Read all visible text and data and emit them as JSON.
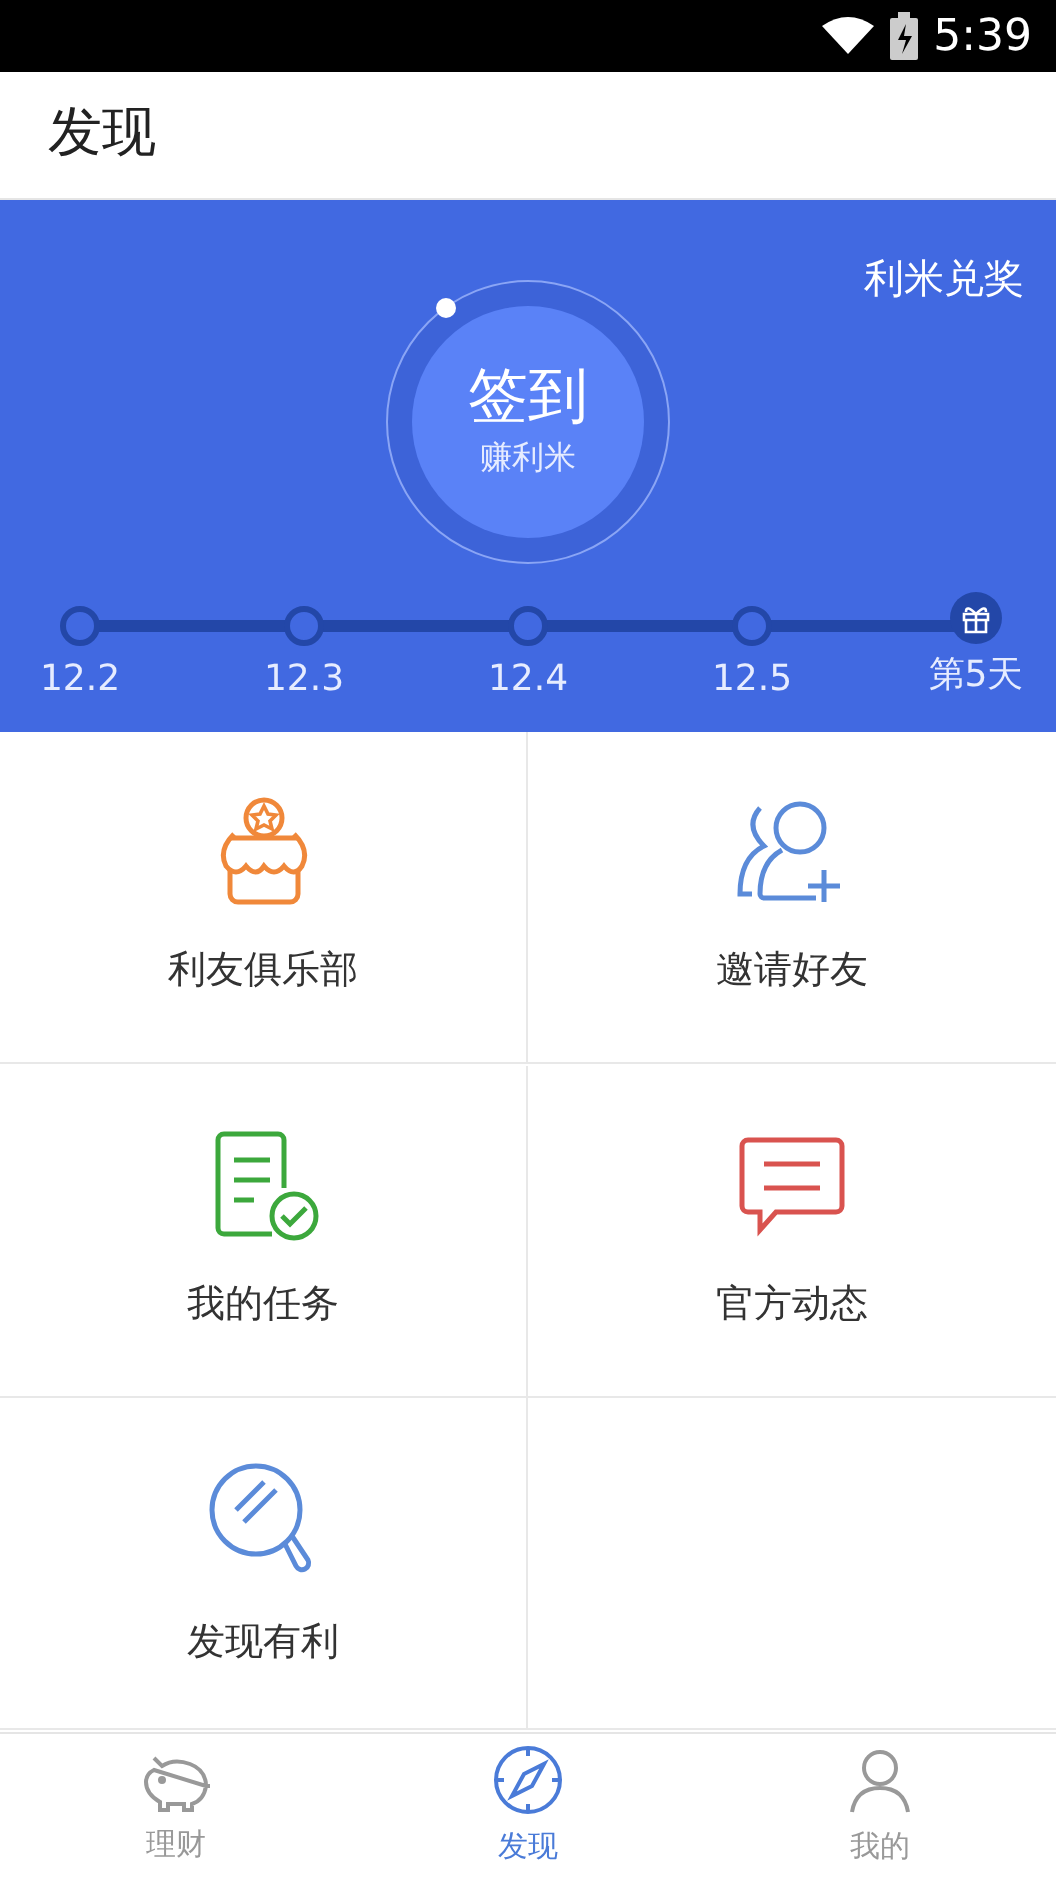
{
  "status_bar": {
    "time": "5:39"
  },
  "header": {
    "title": "发现"
  },
  "banner": {
    "link": "利米兑奖",
    "checkin": {
      "title": "签到",
      "subtitle": "赚利米"
    },
    "timeline": [
      {
        "label": "12.2",
        "kind": "dot"
      },
      {
        "label": "12.3",
        "kind": "dot"
      },
      {
        "label": "12.4",
        "kind": "dot"
      },
      {
        "label": "12.5",
        "kind": "dot"
      },
      {
        "label": "第5天",
        "kind": "gift"
      }
    ]
  },
  "grid": [
    {
      "label": "利友俱乐部",
      "kind": "club"
    },
    {
      "label": "邀请好友",
      "kind": "invite"
    },
    {
      "label": "我的任务",
      "kind": "task"
    },
    {
      "label": "官方动态",
      "kind": "news"
    },
    {
      "label": "发现有利",
      "kind": "discover"
    }
  ],
  "bottom_nav": [
    {
      "label": "理财",
      "kind": "piggy",
      "selected": false
    },
    {
      "label": "发现",
      "kind": "compass",
      "selected": true
    },
    {
      "label": "我的",
      "kind": "person",
      "selected": false
    }
  ]
}
